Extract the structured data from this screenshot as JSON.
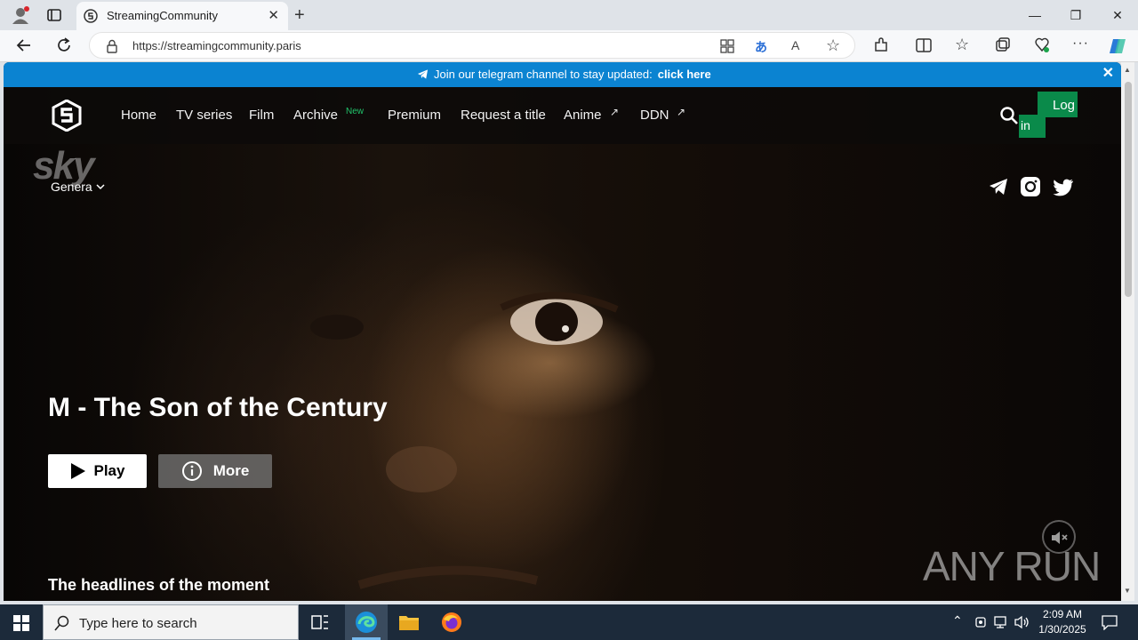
{
  "browser": {
    "tab_title": "StreamingCommunity",
    "url": "https://streamingcommunity.paris"
  },
  "banner": {
    "message": "Join our telegram channel to stay updated:",
    "link_text": "click here"
  },
  "nav": {
    "items": [
      {
        "label": "Home"
      },
      {
        "label": "TV series"
      },
      {
        "label": "Film"
      },
      {
        "label": "Archive",
        "badge": "New"
      },
      {
        "label": "Premium"
      },
      {
        "label": "Request a title"
      },
      {
        "label": "Anime",
        "external": true
      },
      {
        "label": "DDN",
        "external": true
      }
    ],
    "login_line1": "Log",
    "login_line2": "in"
  },
  "hero": {
    "channel_logo": "sky",
    "genre_label": "Genera",
    "title": "M - The Son of the Century",
    "play_label": "Play",
    "more_label": "More",
    "section_heading": "The headlines of the moment"
  },
  "watermark": "ANY RUN",
  "taskbar": {
    "search_placeholder": "Type here to search",
    "time": "2:09 AM",
    "date": "1/30/2025"
  },
  "colors": {
    "banner": "#0b83d1",
    "login": "#0a8a4a",
    "badge": "#21c46b"
  }
}
